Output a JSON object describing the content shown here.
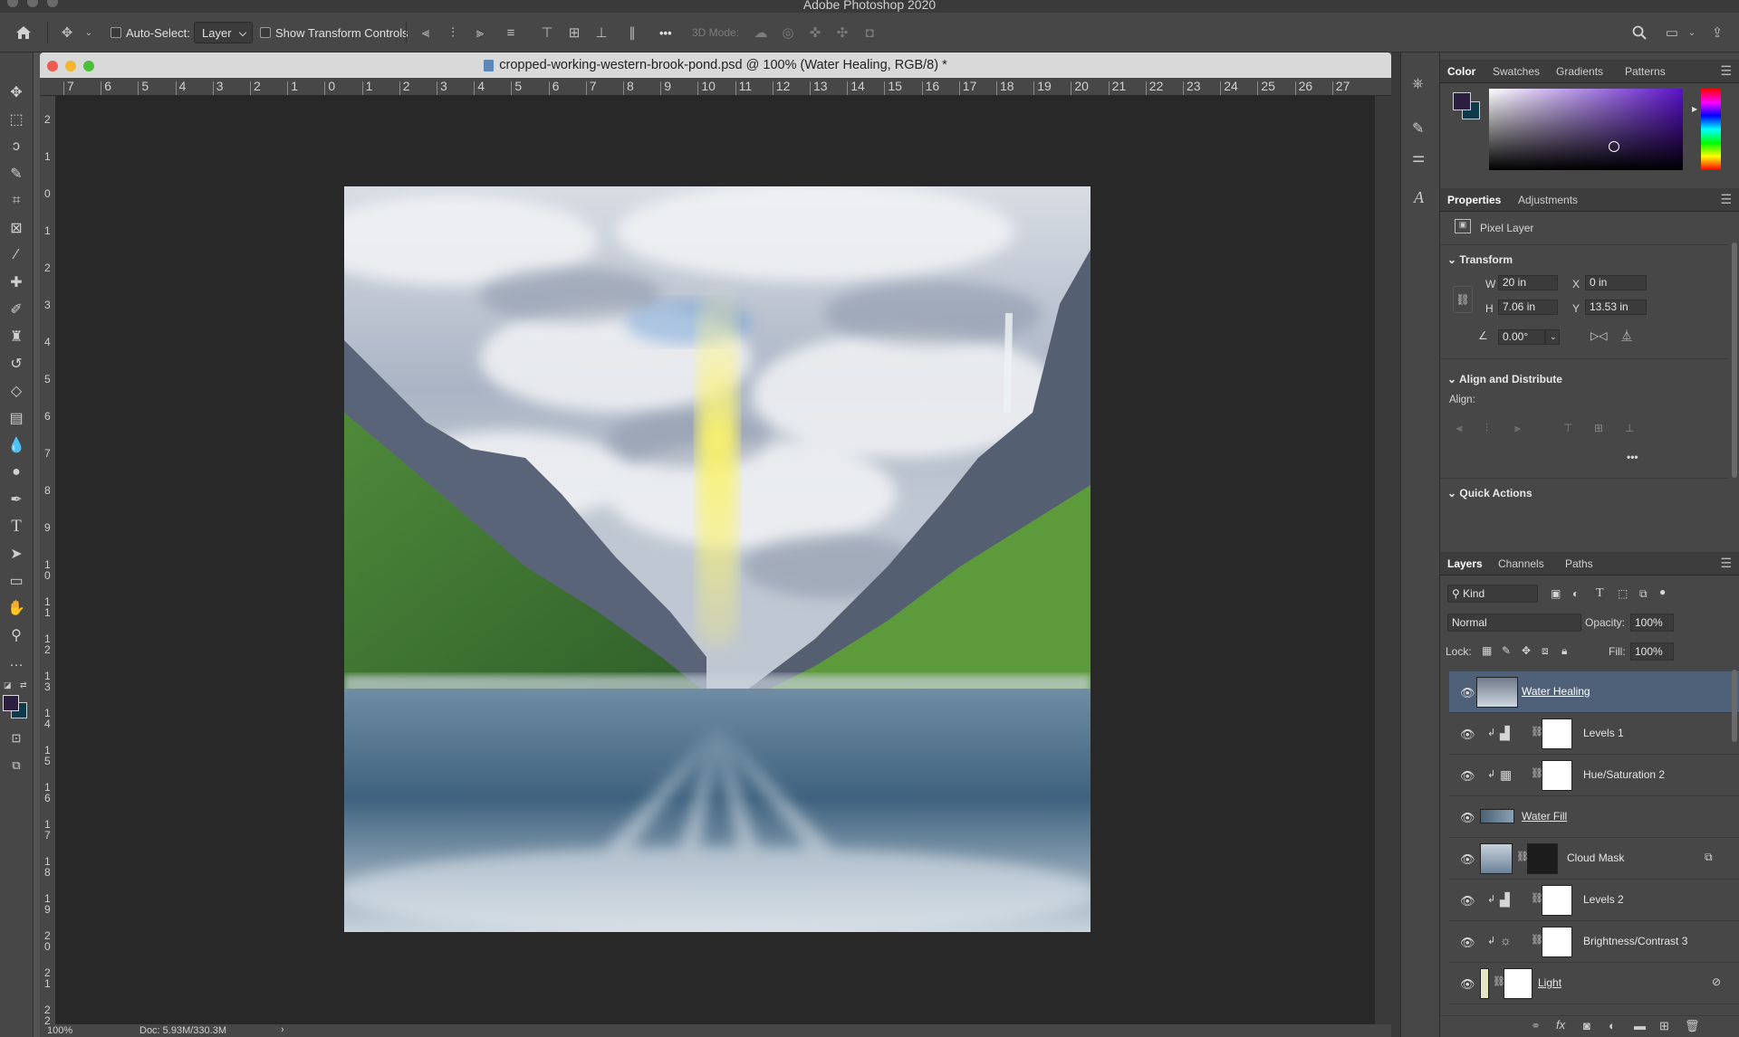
{
  "app": {
    "title": "Adobe Photoshop 2020"
  },
  "options_bar": {
    "auto_select_label": "Auto-Select:",
    "auto_select_value": "Layer",
    "show_transform_label": "Show Transform Controls",
    "mode_3d_label": "3D Mode:",
    "more_label": "•••"
  },
  "document": {
    "tab_title": "cropped-working-western-brook-pond.psd @ 100% (Water Healing, RGB/8) *",
    "ruler_h": [
      "7",
      "6",
      "5",
      "4",
      "3",
      "2",
      "1",
      "0",
      "1",
      "2",
      "3",
      "4",
      "5",
      "6",
      "7",
      "8",
      "9",
      "10",
      "11",
      "12",
      "13",
      "14",
      "15",
      "16",
      "17",
      "18",
      "19",
      "20",
      "21",
      "22",
      "23",
      "24",
      "25",
      "26",
      "27"
    ],
    "ruler_v": [
      "2",
      "1",
      "0",
      "1",
      "2",
      "3",
      "4",
      "5",
      "6",
      "7",
      "8",
      "9",
      "1\n0",
      "1\n1",
      "1\n2",
      "1\n3",
      "1\n4",
      "1\n5",
      "1\n6",
      "1\n7",
      "1\n8",
      "1\n9",
      "2\n0",
      "2\n1",
      "2\n2"
    ],
    "zoom": "100%",
    "doc_size": "Doc: 5.93M/330.3M"
  },
  "colors": {
    "foreground": "#2b1e3e",
    "background": "#0f3a4a",
    "picker_hue": "#5a10c8",
    "selection": "#4f6179"
  },
  "color_panel": {
    "tabs": [
      "Color",
      "Swatches",
      "Gradients",
      "Patterns"
    ]
  },
  "properties_panel": {
    "tabs": [
      "Properties",
      "Adjustments"
    ],
    "kind": "Pixel Layer",
    "transform_title": "Transform",
    "w_label": "W",
    "w_value": "20 in",
    "x_label": "X",
    "x_value": "0 in",
    "h_label": "H",
    "h_value": "7.06 in",
    "y_label": "Y",
    "y_value": "13.53 in",
    "angle_value": "0.00°",
    "align_title": "Align and Distribute",
    "align_label": "Align:",
    "quick_actions_title": "Quick Actions"
  },
  "layers_panel": {
    "tabs": [
      "Layers",
      "Channels",
      "Paths"
    ],
    "filter_label": "Kind",
    "blend_mode": "Normal",
    "opacity_label": "Opacity:",
    "opacity_value": "100%",
    "lock_label": "Lock:",
    "fill_label": "Fill:",
    "fill_value": "100%",
    "layers": [
      {
        "name": "Water Healing",
        "selected": true
      },
      {
        "name": "Levels 1"
      },
      {
        "name": "Hue/Saturation 2"
      },
      {
        "name": "Water Fill"
      },
      {
        "name": "Cloud Mask"
      },
      {
        "name": "Levels 2"
      },
      {
        "name": "Brightness/Contrast 3"
      },
      {
        "name": "Light"
      }
    ]
  }
}
